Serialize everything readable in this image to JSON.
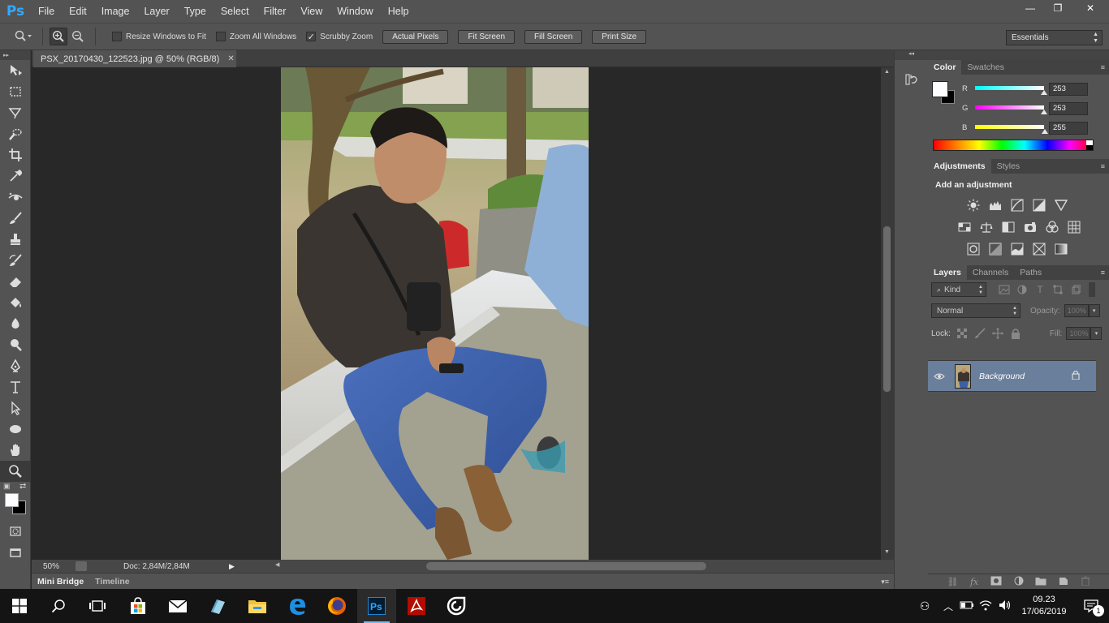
{
  "app": {
    "logo": "Ps"
  },
  "menu": [
    "File",
    "Edit",
    "Image",
    "Layer",
    "Type",
    "Select",
    "Filter",
    "View",
    "Window",
    "Help"
  ],
  "window_controls": {
    "minimize": "—",
    "restore": "❐",
    "close": "✕"
  },
  "options": {
    "resize_windows": "Resize Windows to Fit",
    "resize_windows_checked": false,
    "zoom_all": "Zoom All Windows",
    "zoom_all_checked": false,
    "scrubby_zoom": "Scrubby Zoom",
    "scrubby_zoom_checked": true,
    "buttons": [
      "Actual Pixels",
      "Fit Screen",
      "Fill Screen",
      "Print Size"
    ],
    "workspace": "Essentials"
  },
  "document": {
    "tab_title": "PSX_20170430_122523.jpg @ 50% (RGB/8)",
    "zoom": "50%",
    "doc_size": "Doc: 2,84M/2,84M"
  },
  "bottom_tabs": [
    "Mini Bridge",
    "Timeline"
  ],
  "color_panel": {
    "tabs": [
      "Color",
      "Swatches"
    ],
    "r_label": "R",
    "g_label": "G",
    "b_label": "B",
    "r": "253",
    "g": "253",
    "b": "255",
    "foreground": "#fdfdff",
    "background": "#000000"
  },
  "adjustments_panel": {
    "tabs": [
      "Adjustments",
      "Styles"
    ],
    "title": "Add an adjustment"
  },
  "layers_panel": {
    "tabs": [
      "Layers",
      "Channels",
      "Paths"
    ],
    "kind": "Kind",
    "blend_mode": "Normal",
    "opacity_label": "Opacity:",
    "opacity": "100%",
    "lock_label": "Lock:",
    "fill_label": "Fill:",
    "fill": "100%",
    "layer_name": "Background"
  },
  "taskbar": {
    "time": "09.23",
    "date": "17/06/2019",
    "notifications": "1"
  },
  "colors": {
    "accent": "#31a8ff",
    "panel": "#535353",
    "canvas": "#282828",
    "layer_selected": "#6a7f9b"
  }
}
